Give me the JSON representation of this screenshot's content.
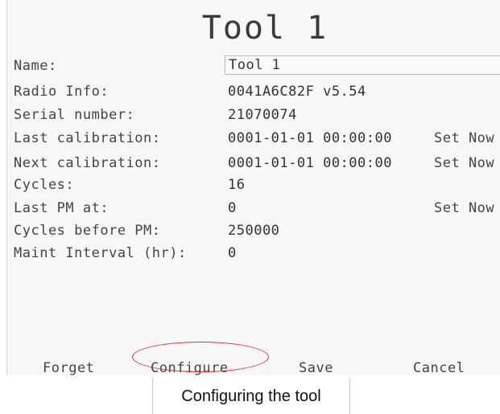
{
  "screen": {
    "title": "Tool 1",
    "fields": [
      {
        "label": "Name:",
        "value": "Tool 1"
      },
      {
        "label": "Radio Info:",
        "value": "0041A6C82F v5.54"
      },
      {
        "label": "Serial number:",
        "value": "21070074"
      },
      {
        "label": "Last calibration:",
        "value": "0001-01-01 00:00:00",
        "action": "Set Now"
      },
      {
        "label": "Next calibration:",
        "value": "0001-01-01 00:00:00",
        "action": "Set Now"
      },
      {
        "label": "Cycles:",
        "value": "16"
      },
      {
        "label": "Last PM at:",
        "value": "0",
        "action": "Set Now"
      },
      {
        "label": "Cycles before PM:",
        "value": "250000"
      },
      {
        "label": "Maint Interval (hr):",
        "value": "0"
      }
    ],
    "buttons": {
      "forget": "Forget",
      "configure": "Configure",
      "save": "Save",
      "cancel": "Cancel"
    },
    "highlight_color": "#e03030"
  },
  "caption": "Configuring the tool"
}
